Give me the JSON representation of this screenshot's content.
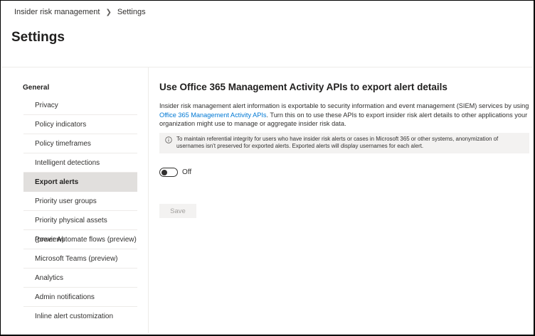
{
  "breadcrumb": {
    "items": [
      "Insider risk management",
      "Settings"
    ]
  },
  "page": {
    "title": "Settings"
  },
  "sidebar": {
    "heading": "General",
    "active_index": 4,
    "items": [
      {
        "label": "Privacy"
      },
      {
        "label": "Policy indicators"
      },
      {
        "label": "Policy timeframes"
      },
      {
        "label": "Intelligent detections"
      },
      {
        "label": "Export alerts"
      },
      {
        "label": "Priority user groups"
      },
      {
        "label": "Priority physical assets (preview)"
      },
      {
        "label": "Power Automate flows (preview)"
      },
      {
        "label": "Microsoft Teams (preview)"
      },
      {
        "label": "Analytics"
      },
      {
        "label": "Admin notifications"
      },
      {
        "label": "Inline alert customization"
      }
    ]
  },
  "main": {
    "title": "Use Office 365 Management Activity APIs to export alert details",
    "description_before_link": "Insider risk management alert information is exportable to security information and event management (SIEM) services by using ",
    "description_link": "Office 365 Management Activity APIs",
    "description_after_link": ". Turn this on to use these APIs to export insider risk alert details to other applications your organization might use to manage or aggregate insider risk data.",
    "info_text": "To maintain referential integrity for users who have insider risk alerts or cases in Microsoft 365 or other systems, anonymization of usernames isn't preserved for exported alerts. Exported alerts will display usernames for each alert.",
    "toggle": {
      "state": "off",
      "label": "Off"
    },
    "save_label": "Save"
  },
  "colors": {
    "link": "#0078d4",
    "active_nav_bg": "#e1dfdd",
    "info_bg": "#f3f2f1",
    "disabled_text": "#a19f9d"
  }
}
